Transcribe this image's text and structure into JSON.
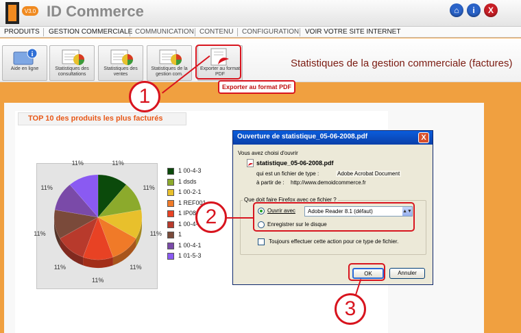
{
  "app": {
    "logo_badge": "V3.0",
    "logo_text": "ID Commerce"
  },
  "header_buttons": {
    "home": "⌂",
    "info": "i",
    "close": "X"
  },
  "menu": [
    {
      "label": "PRODUITS"
    },
    {
      "label": "GESTION COMMERCIALE"
    },
    {
      "label": "COMMUNICATION"
    },
    {
      "label": "CONTENU"
    },
    {
      "label": "CONFIGURATION"
    },
    {
      "label": "VOIR VOTRE SITE INTERNET"
    }
  ],
  "toolbar": {
    "buttons": [
      {
        "label": "Aide en ligne"
      },
      {
        "label": "Statistiques des consultations"
      },
      {
        "label": "Statistiques des ventes"
      },
      {
        "label": "Statistiques de la gestion com."
      },
      {
        "label": "Exporter au format PDF"
      }
    ],
    "page_title": "Statistiques de la gestion commerciale (factures)",
    "tooltip": "Exporter au format PDF"
  },
  "chart_data": {
    "type": "pie",
    "title": "TOP 10 des produits les plus facturés",
    "slice_labels": [
      "11%",
      "11%",
      "11%",
      "11%",
      "11%",
      "11%",
      "11%",
      "11%",
      "11%"
    ],
    "values": [
      11,
      11,
      11,
      11,
      11,
      11,
      11,
      11,
      11
    ],
    "legend": [
      {
        "label": "1 00-4-3",
        "color": "#0b4a0b"
      },
      {
        "label": "1 dsds",
        "color": "#8caa2c"
      },
      {
        "label": "1 00-2-1",
        "color": "#e8c02c"
      },
      {
        "label": "1 REF001",
        "color": "#f07a28"
      },
      {
        "label": "1 IP08",
        "color": "#e84224"
      },
      {
        "label": "1 00-4-",
        "color": "#b83a2c"
      },
      {
        "label": "1",
        "color": "#7a4a3a"
      },
      {
        "label": "1 00-4-1",
        "color": "#7a4aa8"
      },
      {
        "label": "1 01-5-3",
        "color": "#8a5af2"
      }
    ]
  },
  "dialog": {
    "title": "Ouverture de statistique_05-06-2008.pdf",
    "close_label": "X",
    "intro": "Vous avez choisi d'ouvrir",
    "filename": "statistique_05-06-2008.pdf",
    "type_label": "qui est un fichier de type :",
    "type_value": "Adobe Acrobat Document",
    "source_label": "à partir de :",
    "source_value": "http://www.demoidcommerce.fr",
    "question": "Que doit faire Firefox avec ce fichier ?",
    "open_with_label": "Ouvrir avec",
    "open_with_value": "Adobe Reader 8.1 (défaut)",
    "save_label": "Enregistrer sur le disque",
    "always_label": "Toujours effectuer cette action pour ce type de fichier.",
    "ok_label": "OK",
    "cancel_label": "Annuler"
  },
  "steps": [
    "1",
    "2",
    "3"
  ],
  "colors": {
    "accent_red": "#d8141e",
    "background_orange": "#f0a040",
    "title_brown": "#7a1a10"
  }
}
